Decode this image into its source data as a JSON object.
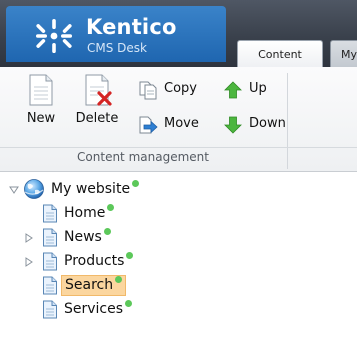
{
  "app": {
    "brand_name": "Kentico",
    "brand_sub": "CMS Desk"
  },
  "tabs": [
    {
      "label": "Content",
      "active": true
    },
    {
      "label": "My",
      "active": false
    }
  ],
  "ribbon": {
    "new_label": "New",
    "delete_label": "Delete",
    "copy_label": "Copy",
    "move_label": "Move",
    "up_label": "Up",
    "down_label": "Down",
    "group_label": "Content management"
  },
  "tree": {
    "root": {
      "label": "My website",
      "status": "published",
      "expanded": true
    },
    "items": [
      {
        "label": "Home",
        "status": "published",
        "has_children": false,
        "selected": false
      },
      {
        "label": "News",
        "status": "published",
        "has_children": true,
        "selected": false
      },
      {
        "label": "Products",
        "status": "published",
        "has_children": true,
        "selected": false
      },
      {
        "label": "Search",
        "status": "published",
        "has_children": false,
        "selected": true
      },
      {
        "label": "Services",
        "status": "published",
        "has_children": false,
        "selected": false
      }
    ]
  },
  "colors": {
    "header_bg": "#3a414c",
    "brand_blue": "#1f66b0",
    "status_published": "#5cc85a",
    "selected_bg": "#fbd69f"
  },
  "icons": {
    "logo": "kentico-logo-icon",
    "new": "new-document-icon",
    "delete": "delete-document-icon",
    "copy": "copy-icon",
    "move": "move-icon",
    "up": "arrow-up-icon",
    "down": "arrow-down-icon",
    "website": "globe-icon",
    "page": "page-icon"
  }
}
